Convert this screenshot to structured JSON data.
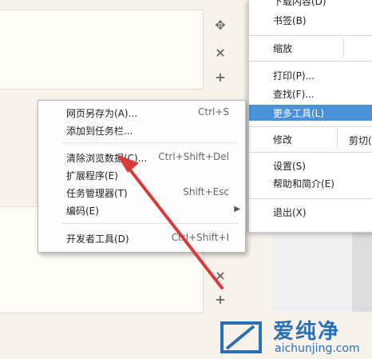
{
  "chrome_menu": {
    "items": [
      {
        "label": "下载内容(D)"
      },
      {
        "label": "书签(B)"
      },
      {
        "label": "缩放"
      },
      {
        "label": "打印(P)..."
      },
      {
        "label": "查找(F)..."
      },
      {
        "label": "更多工具(L)"
      },
      {
        "label": "修改"
      },
      {
        "label": "剪切("
      },
      {
        "label": "设置(S)"
      },
      {
        "label": "帮助和简介(E)"
      },
      {
        "label": "退出(X)"
      }
    ]
  },
  "submenu": {
    "items": [
      {
        "label": "网页另存为(A)...",
        "shortcut": "Ctrl+S"
      },
      {
        "label": "添加到任务栏...",
        "shortcut": ""
      },
      {
        "label": "清除浏览数据(C)...",
        "shortcut": "Ctrl+Shift+Del"
      },
      {
        "label": "扩展程序(E)",
        "shortcut": ""
      },
      {
        "label": "任务管理器(T)",
        "shortcut": "Shift+Esc"
      },
      {
        "label": "编码(E)",
        "shortcut": ""
      },
      {
        "label": "开发者工具(D)",
        "shortcut": "Ctrl+Shift+I"
      }
    ]
  },
  "controls": {
    "move": "✥",
    "close": "×",
    "add": "+"
  },
  "watermark": {
    "brand": "爱纯净",
    "url": "aichunjing.com"
  },
  "colors": {
    "highlight": "#4a91d9",
    "arrow": "#d93a3a",
    "watermark": "#2b6fb6"
  }
}
